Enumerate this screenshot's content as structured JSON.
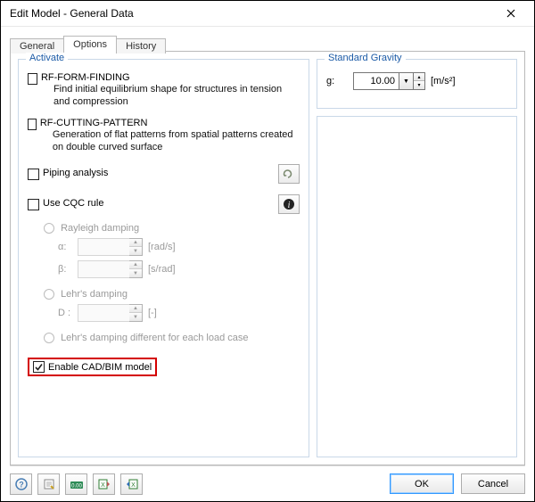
{
  "window": {
    "title": "Edit Model - General Data"
  },
  "tabs": {
    "general": "General",
    "options": "Options",
    "history": "History"
  },
  "activate": {
    "title": "Activate",
    "form": {
      "label": "RF-FORM-FINDING",
      "desc": "Find initial equilibrium shape for structures in tension and compression"
    },
    "cutting": {
      "label": "RF-CUTTING-PATTERN",
      "desc": "Generation of flat patterns from spatial patterns created on double curved surface"
    },
    "piping": "Piping analysis",
    "cqc": "Use CQC rule",
    "rayleigh": "Rayleigh damping",
    "alpha": "α:",
    "alpha_unit": "[rad/s]",
    "beta": "β:",
    "beta_unit": "[s/rad]",
    "lehr": "Lehr's damping",
    "d": "D :",
    "d_unit": "[-]",
    "lehr_diff": "Lehr's damping different for each load case",
    "cad": "Enable CAD/BIM model"
  },
  "gravity": {
    "title": "Standard Gravity",
    "label": "g:",
    "value": "10.00",
    "unit": "[m/s²]"
  },
  "buttons": {
    "ok": "OK",
    "cancel": "Cancel"
  }
}
